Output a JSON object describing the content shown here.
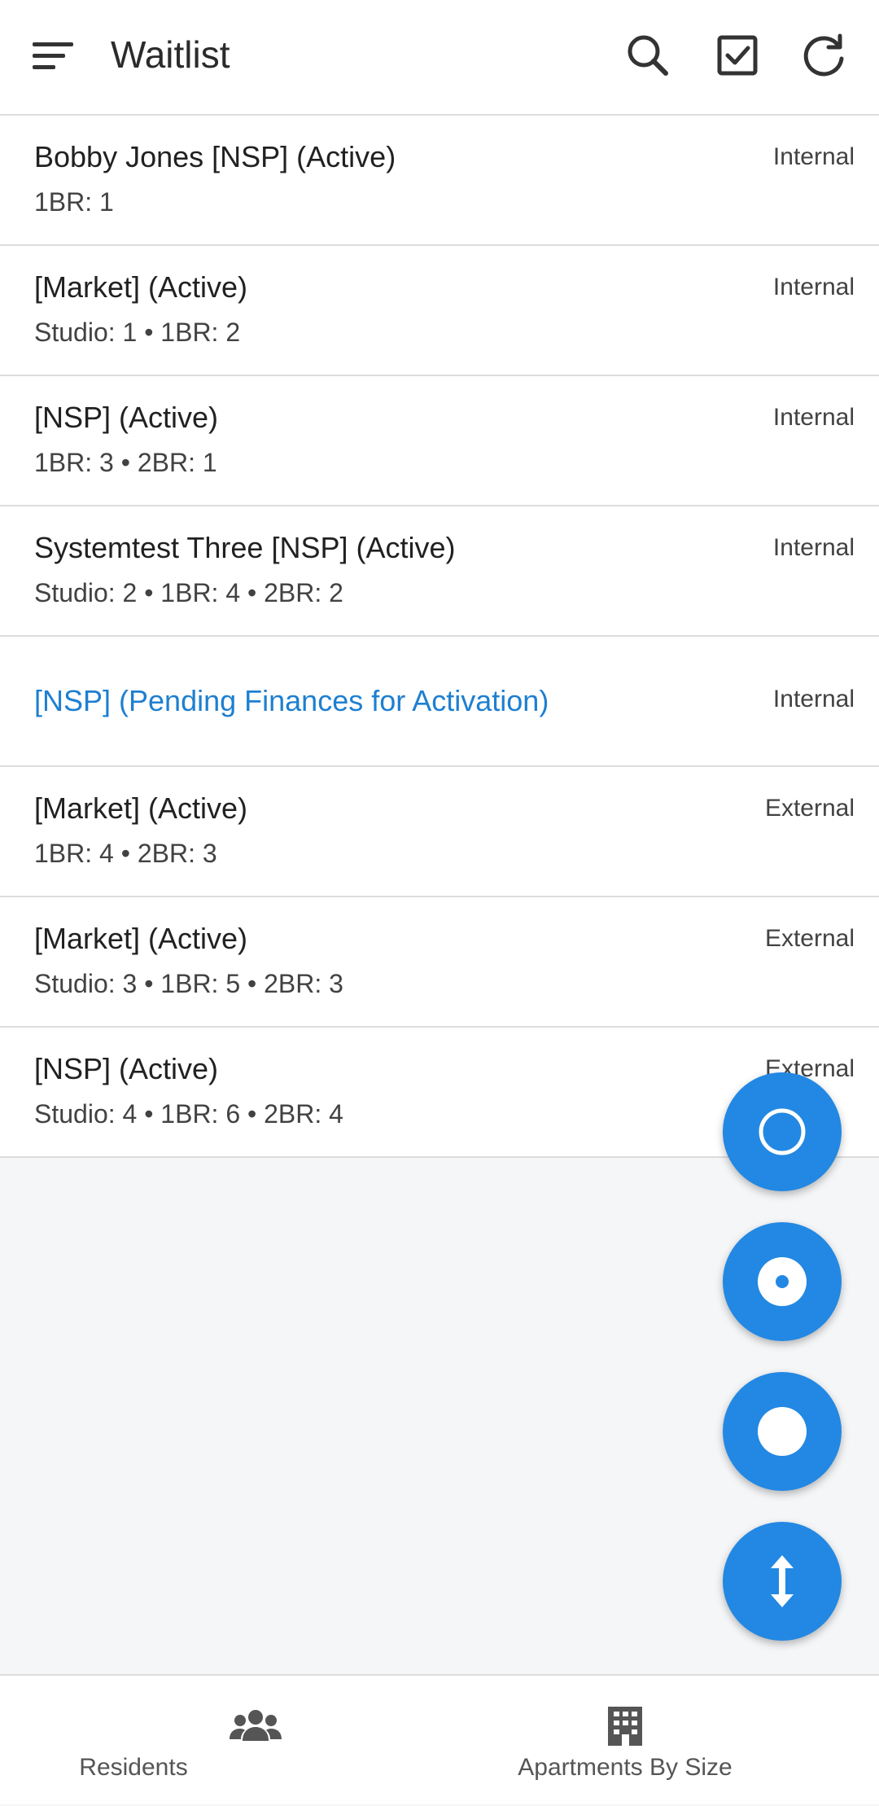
{
  "header": {
    "title": "Waitlist",
    "icons": [
      "menu-icon",
      "search-icon",
      "checkbox-icon",
      "refresh-icon"
    ]
  },
  "list": [
    {
      "title": "Bobby Jones [NSP] (Active)",
      "sub": "1BR: 1",
      "tag": "Internal"
    },
    {
      "title": "[Market] (Active)",
      "sub": "Studio: 1 • 1BR: 2",
      "tag": "Internal"
    },
    {
      "title": "[NSP] (Active)",
      "sub": "1BR: 3 • 2BR: 1",
      "tag": "Internal"
    },
    {
      "title": "Systemtest Three [NSP] (Active)",
      "sub": "Studio: 2 • 1BR: 4 • 2BR: 2",
      "tag": "Internal"
    },
    {
      "title": "[NSP] (Pending Finances for Activation)",
      "sub": "",
      "tag": "Internal"
    },
    {
      "title": "[Market] (Active)",
      "sub": "1BR: 4 • 2BR: 3",
      "tag": "External"
    },
    {
      "title": "[Market] (Active)",
      "sub": "Studio: 3 • 1BR: 5 • 2BR: 3",
      "tag": "External"
    },
    {
      "title": "[NSP] (Active)",
      "sub": "Studio: 4 • 1BR: 6 • 2BR: 4",
      "tag": "External"
    }
  ],
  "fabs": [
    "ring-icon",
    "dot-in-ring-icon",
    "filled-circle-icon",
    "vertical-arrows-icon"
  ],
  "bottom_nav": {
    "residents": "Residents",
    "apartments": "Apartments By Size"
  },
  "colors": {
    "accent": "#2288e3",
    "pending_link": "#1e7fd0"
  }
}
